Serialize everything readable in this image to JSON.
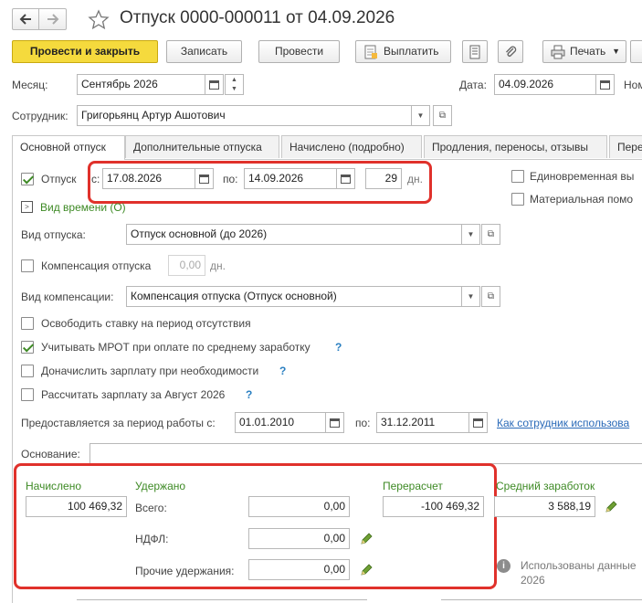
{
  "window": {
    "title": "Отпуск 0000-000011 от 04.09.2026"
  },
  "toolbar": {
    "post_close": "Провести и закрыть",
    "save": "Записать",
    "post": "Провести",
    "pay": "Выплатить",
    "print": "Печать"
  },
  "header": {
    "month_label": "Месяц:",
    "month_value": "Сентябрь 2026",
    "date_label": "Дата:",
    "date_value": "04.09.2026",
    "number_label": "Ном",
    "employee_label": "Сотрудник:",
    "employee_value": "Григорьянц Артур Ашотович"
  },
  "tabs": [
    "Основной отпуск",
    "Дополнительные отпуска",
    "Начислено (подробно)",
    "Продления, переносы, отзывы",
    "Пере"
  ],
  "vacation": {
    "label": "Отпуск",
    "from_label": "с:",
    "from": "17.08.2026",
    "to_label": "по:",
    "to": "14.09.2026",
    "days": "29",
    "days_unit": "дн.",
    "time_type_link": "Вид времени (О)",
    "lump_sum": "Единовременная вы",
    "material_help": "Материальная помо",
    "type_label": "Вид отпуска:",
    "type_value": "Отпуск основной (до 2026)",
    "compensation_label": "Компенсация отпуска",
    "compensation_days": "0,00",
    "compensation_unit": "дн.",
    "comp_type_label": "Вид компенсации:",
    "comp_type_value": "Компенсация отпуска (Отпуск основной)"
  },
  "options": {
    "release_rate": "Освободить ставку на период отсутствия",
    "min_wage": "Учитывать МРОТ при оплате по среднему заработку",
    "extra_pay": "Доначислить зарплату при необходимости",
    "calc_salary": "Рассчитать зарплату за Август 2026",
    "help": "?"
  },
  "period": {
    "label": "Предоставляется за период работы с:",
    "from": "01.01.2010",
    "to_label": "по:",
    "to": "31.12.2011",
    "link": "Как сотрудник использова"
  },
  "basis": {
    "label": "Основание:",
    "value": ""
  },
  "totals": {
    "accrued_label": "Начислено",
    "accrued_value": "100 469,32",
    "withheld_label": "Удержано",
    "total_label": "Всего:",
    "total_value": "0,00",
    "ndfl_label": "НДФЛ:",
    "ndfl_value": "0,00",
    "other_label": "Прочие удержания:",
    "other_value": "0,00",
    "recalc_label": "Перерасчет",
    "recalc_value": "-100 469,32",
    "avg_label": "Средний заработок",
    "avg_value": "3 588,19",
    "used_data_line1": "Использованы данные",
    "used_data_line2": "2026"
  },
  "colors": {
    "accent": "#f5da3d",
    "highlight": "#e0312b",
    "green": "#3e8a25",
    "link": "#2a7fc1"
  },
  "icons": [
    "back-arrow-icon",
    "forward-arrow-icon",
    "star-icon",
    "calendar-icon",
    "spin-icon",
    "dropdown-icon",
    "open-icon",
    "pencil-icon",
    "paperclip-icon",
    "document-icon",
    "printer-icon",
    "checkbox-icon"
  ]
}
